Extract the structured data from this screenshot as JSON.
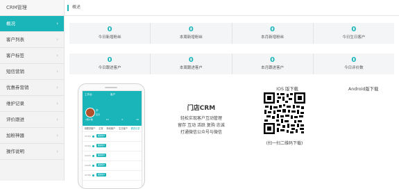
{
  "sidebar": {
    "brand": "CRM管理",
    "items": [
      {
        "label": "概况",
        "active": true
      },
      {
        "label": "客户列表"
      },
      {
        "label": "客户标签"
      },
      {
        "label": "短信营销"
      },
      {
        "label": "优惠券营销"
      },
      {
        "label": "维护记录"
      },
      {
        "label": "评价跟进"
      },
      {
        "label": "加粉神器"
      },
      {
        "label": "操作说明"
      }
    ]
  },
  "breadcrumb": "概述",
  "stats_row1": [
    {
      "value": "0",
      "label": "今日新增粉丝"
    },
    {
      "value": "0",
      "label": "本周新增粉丝"
    },
    {
      "value": "0",
      "label": "本月新增粉丝"
    },
    {
      "value": "0",
      "label": "今日生日客户"
    }
  ],
  "stats_row2": [
    {
      "value": "0",
      "label": "今日跟进客户"
    },
    {
      "value": "0",
      "label": "本周跟进客户"
    },
    {
      "value": "0",
      "label": "本月跟进客户"
    },
    {
      "value": "0",
      "label": "今日评价数"
    }
  ],
  "phone": {
    "header_left": "工作台",
    "header_center": "客户",
    "profile_name": "华",
    "profile_sub": "店长",
    "profile_stats": [
      "1客户数",
      "10",
      "0",
      "10"
    ],
    "tabs": [
      "待跟进客户",
      "正常",
      "新增客户",
      "生日客户",
      "跟进记录"
    ],
    "rows": [
      "13:15",
      "13:15",
      "14:15",
      "14:25",
      "13:55"
    ],
    "pill": "跟进客户"
  },
  "promo": {
    "title": "门店CRM",
    "line1": "轻松实现客户互动管理",
    "line2": "留存 互动 活跃 复购 忠诚",
    "line3": "打通微信公众号与微信"
  },
  "download": {
    "ios_label": "IOS 版下载",
    "android_label": "Android版下载",
    "qr_caption": "(扫一扫二维码下载)"
  },
  "colors": {
    "accent": "#1ab5b9",
    "panel": "#f4f5f7",
    "sidebar": "#f3f3f3"
  },
  "icons": {
    "nav_chevron": "chevron-right-icon",
    "qr": "qr-code-icon"
  }
}
